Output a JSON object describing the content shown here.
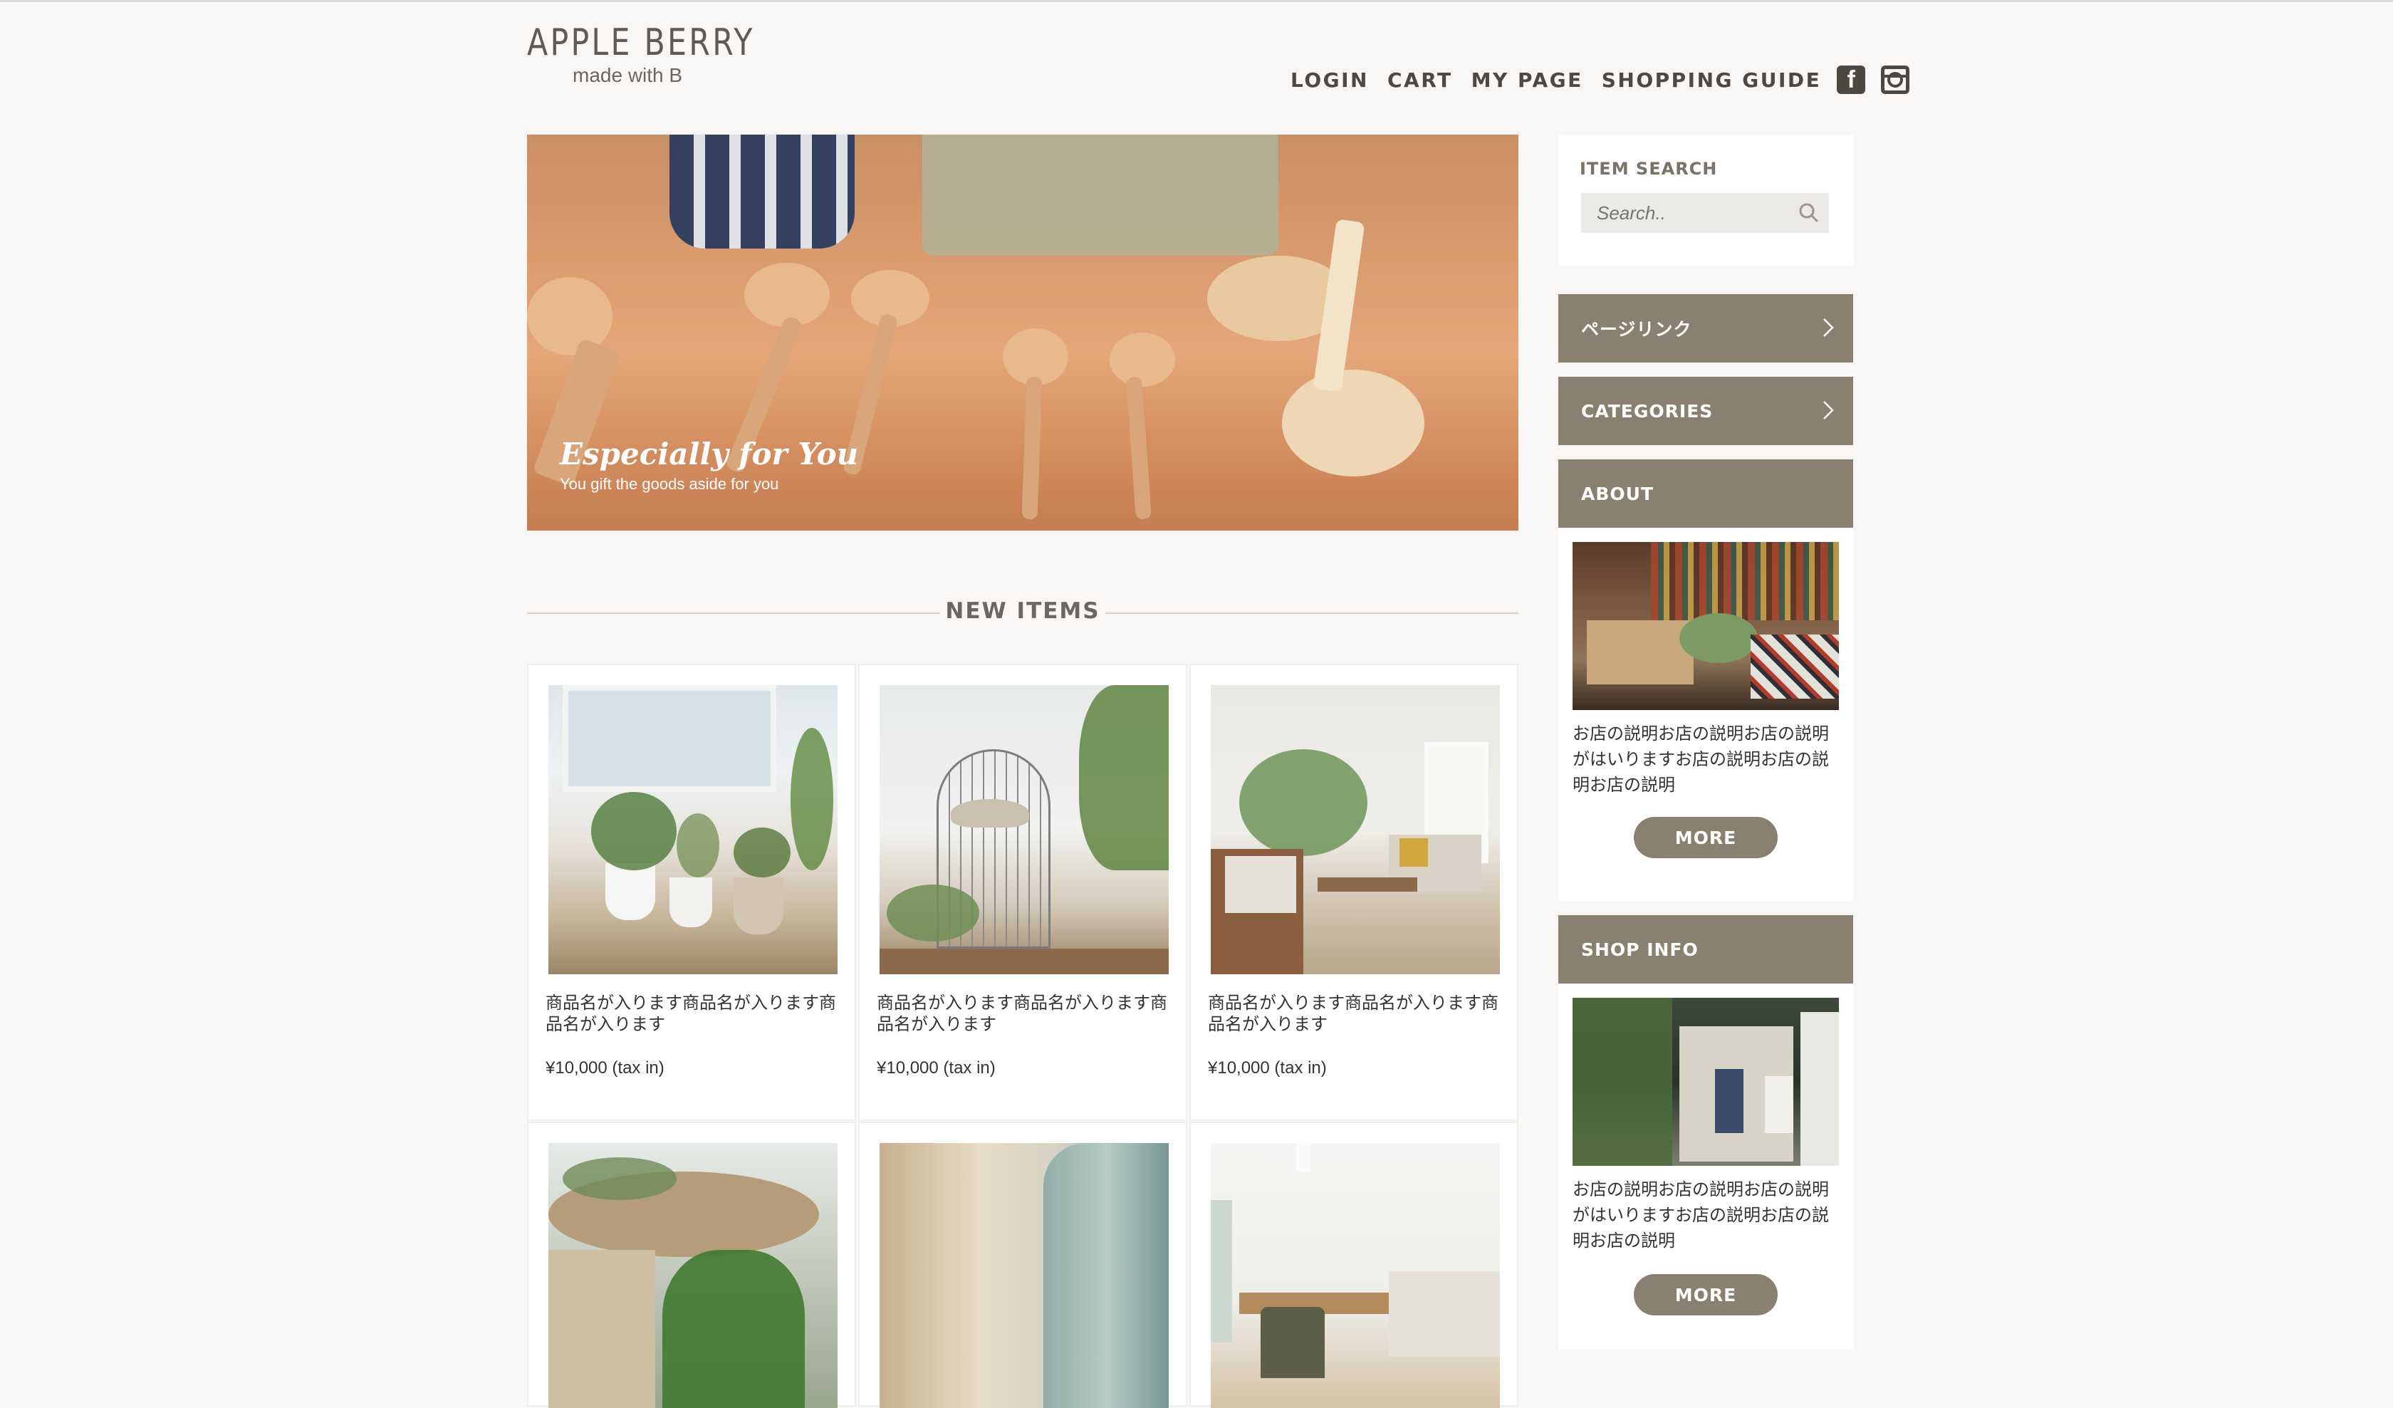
{
  "header": {
    "logo_title": "APPLE BERRY",
    "logo_subtitle": "made with B",
    "nav": [
      "LOGIN",
      "CART",
      "MY PAGE",
      "SHOPPING GUIDE"
    ],
    "social": [
      "facebook-icon",
      "instagram-icon"
    ]
  },
  "hero": {
    "title": "Especially for You",
    "subtitle": "You gift the goods aside for you"
  },
  "new_items": {
    "heading": "NEW ITEMS",
    "items": [
      {
        "name": "商品名が入ります商品名が入ります商品名が入ります",
        "price": "¥10,000 (tax in)"
      },
      {
        "name": "商品名が入ります商品名が入ります商品名が入ります",
        "price": "¥10,000 (tax in)"
      },
      {
        "name": "商品名が入ります商品名が入ります商品名が入ります",
        "price": "¥10,000 (tax in)"
      },
      {
        "name": "",
        "price": ""
      },
      {
        "name": "",
        "price": ""
      },
      {
        "name": "",
        "price": ""
      }
    ]
  },
  "sidebar": {
    "search_title": "ITEM SEARCH",
    "search_placeholder": "Search..",
    "menu": [
      "ページリンク",
      "CATEGORIES",
      "ABOUT",
      "SHOP INFO"
    ],
    "about_text": "お店の説明お店の説明お店の説明がはいりますお店の説明お店の説明お店の説明",
    "about_more": "MORE",
    "shop_text": "お店の説明お店の説明お店の説明がはいりますお店の説明お店の説明お店の説明",
    "shop_more": "MORE"
  },
  "colors": {
    "accent": "#8a806f",
    "background": "#f8f7f5",
    "text": "#333333"
  }
}
